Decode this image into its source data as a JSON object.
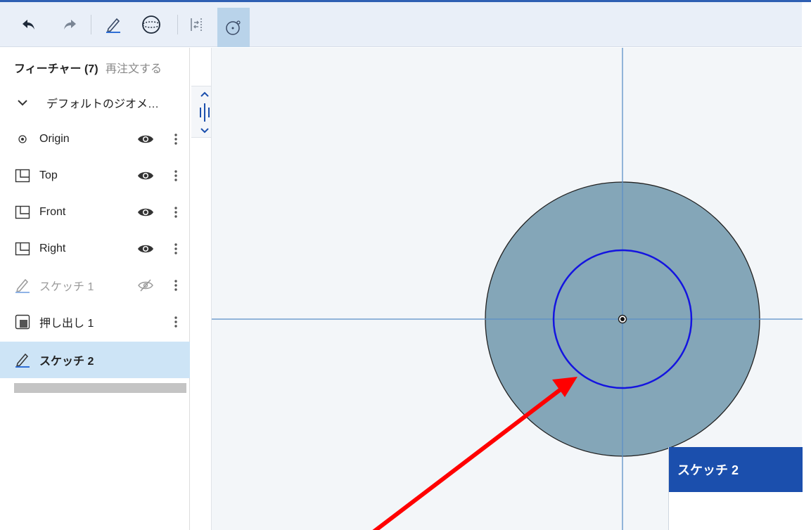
{
  "toolbar": {
    "buttons": [
      "undo-icon",
      "redo-icon",
      "sketch-icon",
      "sphere-icon",
      "mate-align-icon",
      "circle-tool-icon"
    ],
    "active": "circle-tool-icon",
    "accent": "#2f5fb3"
  },
  "features": {
    "title": "フィーチャー (7)",
    "reorder_label": "再注文する",
    "group_label": "デフォルトのジオメ…",
    "items": [
      {
        "label": "Origin",
        "icon": "origin-icon",
        "visible": true
      },
      {
        "label": "Top",
        "icon": "plane-icon",
        "visible": true
      },
      {
        "label": "Front",
        "icon": "plane-icon",
        "visible": true
      },
      {
        "label": "Right",
        "icon": "plane-icon",
        "visible": true
      },
      {
        "label": "スケッチ 1",
        "icon": "sketch-icon",
        "visible": false
      },
      {
        "label": "押し出し 1",
        "icon": "extrude-icon"
      },
      {
        "label": "スケッチ 2",
        "icon": "sketch-icon",
        "selected": true
      }
    ]
  },
  "sketch_panel": {
    "title": "スケッチ 2",
    "header_color": "#1b4fad"
  },
  "colors": {
    "solid_fill": "#84a6b8",
    "circle_stroke": "#1414e0",
    "axis": "#5b8fc7",
    "annotation_arrow": "#ff0000",
    "selection": "#cde4f6"
  }
}
